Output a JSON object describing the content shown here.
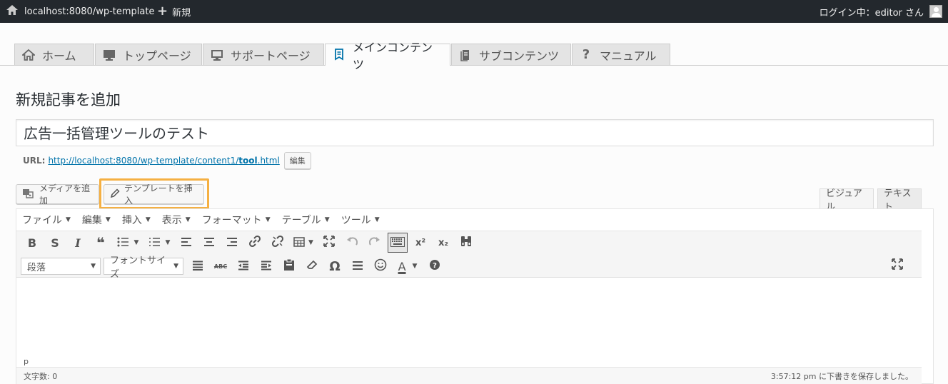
{
  "adminbar": {
    "site": "localhost:8080/wp-template",
    "new": "新規",
    "user": "ログイン中：editor さん"
  },
  "tabs": [
    {
      "label": "ホーム",
      "icon": "home-icon"
    },
    {
      "label": "トップページ",
      "icon": "monitor-icon"
    },
    {
      "label": "サポートページ",
      "icon": "monitor-outline-icon"
    },
    {
      "label": "メインコンテンツ",
      "icon": "document-icon",
      "active": true
    },
    {
      "label": "サブコンテンツ",
      "icon": "pages-icon"
    },
    {
      "label": "マニュアル",
      "icon": "question-icon"
    }
  ],
  "page": {
    "title": "新規記事を追加",
    "post_title": "広告一括管理ツールのテスト",
    "url_label": "URL:",
    "url_prefix": "http://localhost:8080/wp-template/content1/",
    "url_slug": "tool",
    "url_suffix": ".html",
    "edit_button": "編集"
  },
  "media": {
    "add_media": "メディアを追加",
    "insert_template": "テンプレートを挿入"
  },
  "editor_tabs": {
    "visual": "ビジュアル",
    "text": "テキスト"
  },
  "menubar": [
    "ファイル",
    "編集",
    "挿入",
    "表示",
    "フォーマット",
    "テーブル",
    "ツール"
  ],
  "toolbar": {
    "format_select": "段落",
    "font_size_select": "フォントサイズ",
    "bold": "B",
    "strike": "S",
    "italic": "I",
    "quote": "❝",
    "special_char": "Ω",
    "text_color": "A",
    "sup": "x²",
    "sub": "x₂"
  },
  "editor": {
    "path": "p",
    "word_count": "文字数: 0",
    "saved": "3:57:12 pm に下書きを保存しました。"
  },
  "colors": {
    "adminbar": "#23282d",
    "link": "#0073aa",
    "highlight": "#f5b042"
  }
}
